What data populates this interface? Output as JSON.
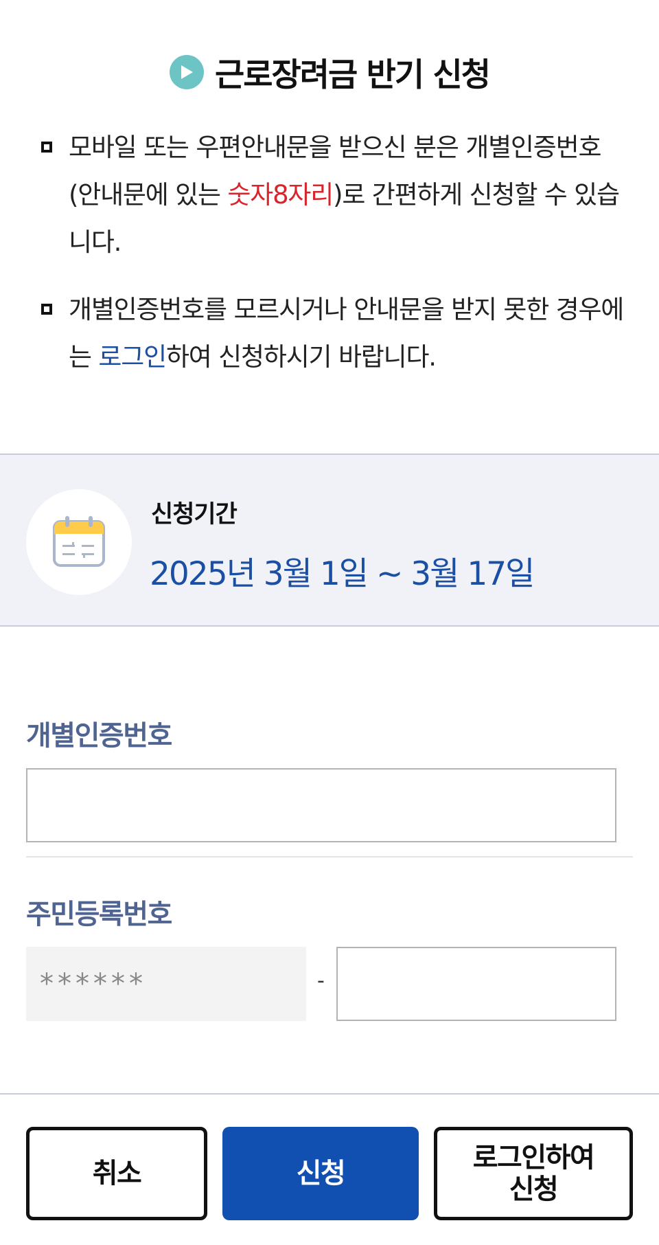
{
  "header": {
    "title": "근로장려금 반기 신청",
    "icon": "play-circle-icon"
  },
  "notices": [
    {
      "before": "모바일 또는 우편안내문을 받으신 분은 개별인증번호(안내문에 있는 ",
      "highlight": "숫자8자리",
      "after": ")로 간편하게 신청할 수 있습니다."
    },
    {
      "before": "개별인증번호를 모르시거나 안내문을 받지 못한 경우에는 ",
      "link": "로그인",
      "after": "하여 신청하시기 바랍니다."
    }
  ],
  "period": {
    "icon": "calendar-icon",
    "label": "신청기간",
    "value": "2025년 3월 1일 ~ 3월 17일"
  },
  "form": {
    "auth_label": "개별인증번호",
    "auth_value": "",
    "rrn_label": "주민등록번호",
    "rrn_front_masked": "******",
    "rrn_separator": "-",
    "rrn_back_value": ""
  },
  "buttons": {
    "cancel": "취소",
    "apply": "신청",
    "login_apply_line1": "로그인하여",
    "login_apply_line2": "신청"
  },
  "colors": {
    "accent_blue": "#1150b0",
    "highlight_red": "#d6262b",
    "label_blue": "#4f6490",
    "icon_teal": "#6cc4c4"
  }
}
